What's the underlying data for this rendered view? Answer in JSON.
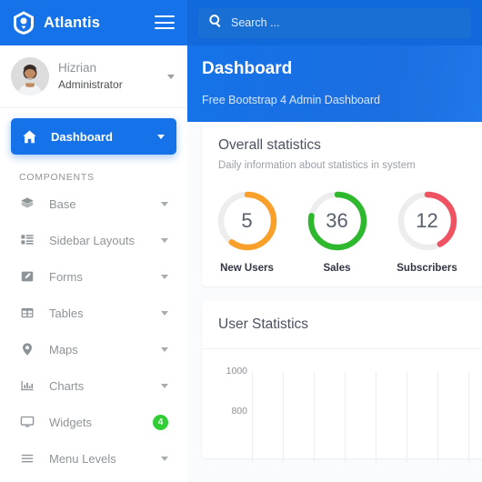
{
  "brand": {
    "name": "Atlantis",
    "logo_icon": "atlantis-hexagon-logo",
    "menu_icon": "hamburger-menu-icon"
  },
  "user": {
    "name": "Hizrian",
    "role": "Administrator",
    "avatar_icon": "user-avatar-photo",
    "caret_icon": "chevron-down-icon"
  },
  "sidebar": {
    "active_item": {
      "label": "Dashboard",
      "icon": "home-icon",
      "caret": "chevron-down-icon"
    },
    "section_label": "COMPONENTS",
    "items": [
      {
        "label": "Base",
        "icon": "layers-icon",
        "caret": "chevron-down-icon",
        "badge": null
      },
      {
        "label": "Sidebar Layouts",
        "icon": "list-grid-icon",
        "caret": "chevron-down-icon",
        "badge": null
      },
      {
        "label": "Forms",
        "icon": "pencil-square-icon",
        "caret": "chevron-down-icon",
        "badge": null
      },
      {
        "label": "Tables",
        "icon": "table-icon",
        "caret": "chevron-down-icon",
        "badge": null
      },
      {
        "label": "Maps",
        "icon": "map-pin-icon",
        "caret": "chevron-down-icon",
        "badge": null
      },
      {
        "label": "Charts",
        "icon": "bar-chart-icon",
        "caret": "chevron-down-icon",
        "badge": null
      },
      {
        "label": "Widgets",
        "icon": "monitor-icon",
        "caret": null,
        "badge": "4"
      },
      {
        "label": "Menu Levels",
        "icon": "menu-lines-icon",
        "caret": "chevron-down-icon",
        "badge": null
      }
    ]
  },
  "topbar": {
    "search_icon": "search-icon",
    "search_placeholder": "Search ..."
  },
  "banner": {
    "title": "Dashboard",
    "subtitle": "Free Bootstrap 4 Admin Dashboard"
  },
  "overall": {
    "title": "Overall statistics",
    "subtitle": "Daily information about statistics in system",
    "stats": [
      {
        "value": "5",
        "label": "New Users",
        "color": "#f8a02a",
        "percent": 60
      },
      {
        "value": "36",
        "label": "Sales",
        "color": "#2eb82e",
        "percent": 78
      },
      {
        "value": "12",
        "label": "Subscribers",
        "color": "#ef5261",
        "percent": 42
      }
    ],
    "track_color": "#ededed"
  },
  "user_statistics": {
    "title": "User Statistics"
  },
  "chart_data": {
    "type": "line",
    "title": "User Statistics",
    "xlabel": "",
    "ylabel": "",
    "ylim": [
      0,
      1000
    ],
    "yticks": [
      "1000",
      "800"
    ],
    "grid": true,
    "gridline_count": 9,
    "categories": [],
    "series": []
  },
  "colors": {
    "primary": "#1572e8",
    "topbar": "#1269db",
    "badge_green": "#31ce36",
    "page_bg": "#f9fbfd"
  }
}
